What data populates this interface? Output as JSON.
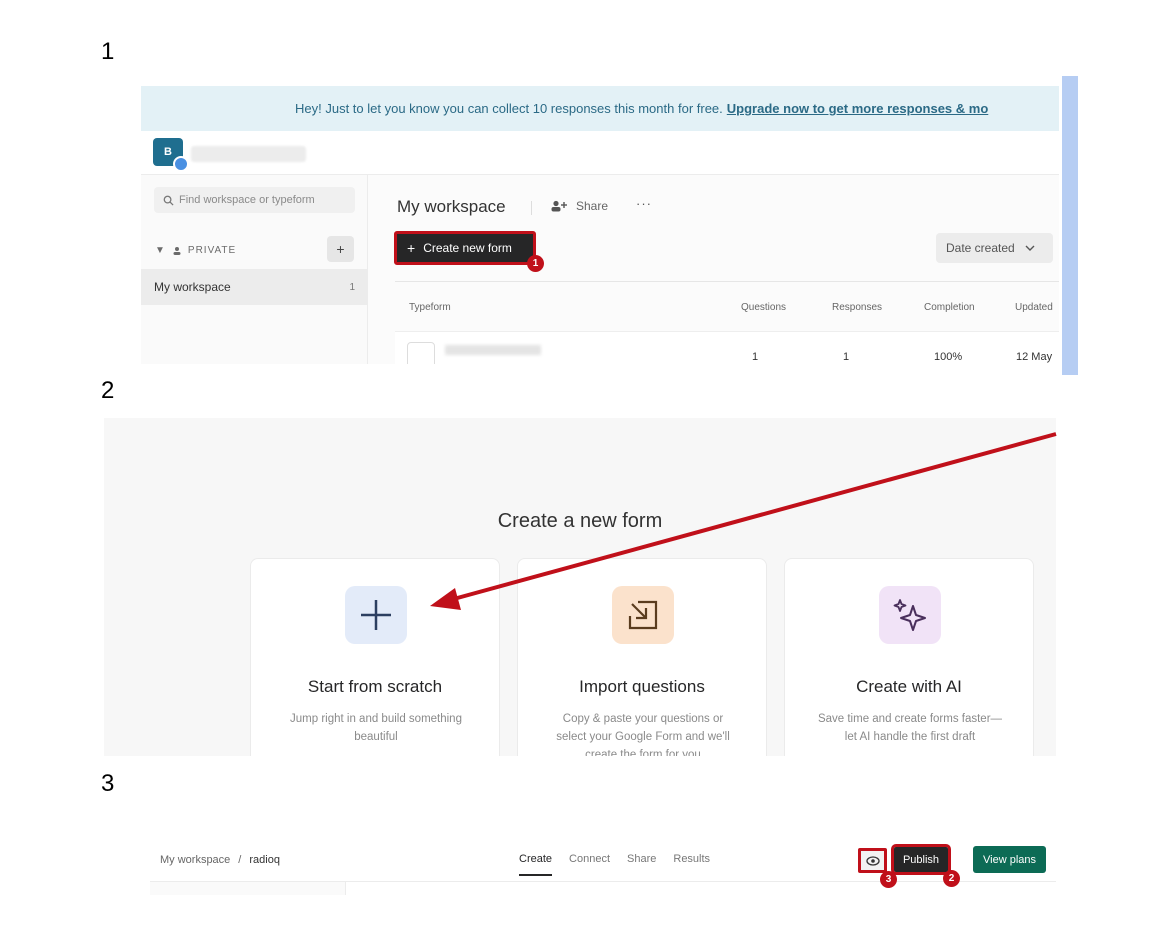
{
  "steps": [
    "1",
    "2",
    "3"
  ],
  "panel1": {
    "banner_text": "Hey! Just to let you know you can collect 10 responses this month for free.",
    "banner_link": "Upgrade now to get more responses & mo",
    "avatar_letter": "B",
    "search_placeholder": "Find workspace or typeform",
    "private_label": "PRIVATE",
    "add_label": "+",
    "workspace_item": "My workspace",
    "workspace_count": "1",
    "workspace_title": "My workspace",
    "share_label": "Share",
    "more_label": "···",
    "create_button": "Create new form",
    "create_marker": "1",
    "sort_label": "Date created",
    "columns": [
      "Typeform",
      "Questions",
      "Responses",
      "Completion",
      "Updated"
    ],
    "row": {
      "questions": "1",
      "responses": "1",
      "completion": "100%",
      "updated": "12 May"
    }
  },
  "panel2": {
    "title": "Create a new form",
    "cards": [
      {
        "title": "Start from scratch",
        "desc": "Jump right in and build something beautiful",
        "icon": "plus-icon",
        "color": "#e3ebf9"
      },
      {
        "title": "Import questions",
        "desc": "Copy & paste your questions or select your Google Form and we'll create the form for you",
        "icon": "import-icon",
        "color": "#fbe2cc"
      },
      {
        "title": "Create with AI",
        "desc": "Save time and create forms faster—let AI handle the first draft",
        "icon": "sparkle-icon",
        "color": "#f1e3f7"
      }
    ]
  },
  "panel3": {
    "crumb_root": "My workspace",
    "crumb_sep": "/",
    "crumb_current": "radioq",
    "tabs": [
      "Create",
      "Connect",
      "Share",
      "Results"
    ],
    "publish": "Publish",
    "view_plans": "View plans",
    "eye_marker": "3",
    "publish_marker": "2"
  },
  "colors": {
    "annotation_red": "#c0101a",
    "green": "#0c6b55",
    "dark": "#262627"
  }
}
